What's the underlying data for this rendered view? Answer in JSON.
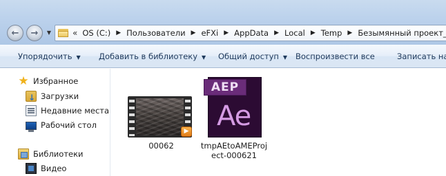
{
  "address": {
    "overflow_glyph": "«",
    "crumbs": [
      "OS (C:)",
      "Пользователи",
      "eFXi",
      "AppData",
      "Local",
      "Temp",
      "Безымянный проект_AME"
    ]
  },
  "toolbar": {
    "organize": "Упорядочить",
    "add_to_library": "Добавить в библиотеку",
    "share": "Общий доступ",
    "play_all": "Воспроизвести все",
    "burn": "Записать на д"
  },
  "navpane": {
    "favorites": "Избранное",
    "downloads": "Загрузки",
    "recent": "Недавние места",
    "desktop": "Рабочий стол",
    "libraries": "Библиотеки",
    "video": "Видео"
  },
  "files": [
    {
      "name": "00062",
      "type": "video"
    },
    {
      "name_line1": "tmpAEtoAMEProj",
      "name_line2": "ect-000621",
      "type": "after-effects-project",
      "badge": "AEP",
      "logo": "Ae"
    }
  ],
  "icons": {
    "back": "back-arrow-icon",
    "forward": "forward-arrow-icon",
    "accent": "#6a2c79",
    "ae_logo": "#d59be4"
  }
}
